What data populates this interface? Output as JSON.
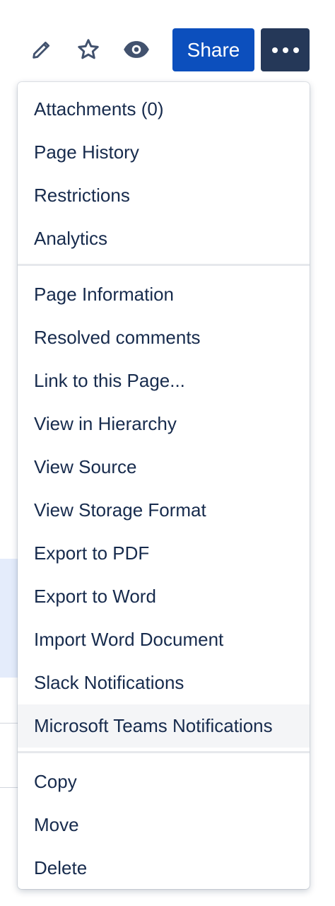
{
  "colors": {
    "primary": "#0c4fbd",
    "dark_button": "#253858",
    "text": "#172b4d",
    "icon": "#42526e",
    "highlight": "#f4f5f7"
  },
  "toolbar": {
    "icons": [
      "pencil-icon",
      "star-icon",
      "eye-icon"
    ],
    "share_label": "Share",
    "more_icon": "ellipsis-icon"
  },
  "menu": {
    "groups": [
      {
        "items": [
          {
            "label": "Attachments (0)"
          },
          {
            "label": "Page History"
          },
          {
            "label": "Restrictions"
          },
          {
            "label": "Analytics"
          }
        ]
      },
      {
        "items": [
          {
            "label": "Page Information"
          },
          {
            "label": "Resolved comments"
          },
          {
            "label": "Link to this Page..."
          },
          {
            "label": "View in Hierarchy"
          },
          {
            "label": "View Source"
          },
          {
            "label": "View Storage Format"
          },
          {
            "label": "Export to PDF"
          },
          {
            "label": "Export to Word"
          },
          {
            "label": "Import Word Document"
          },
          {
            "label": "Slack Notifications"
          },
          {
            "label": "Microsoft Teams Notifications",
            "highlighted": true
          }
        ]
      },
      {
        "items": [
          {
            "label": "Copy"
          },
          {
            "label": "Move"
          },
          {
            "label": "Delete"
          }
        ]
      }
    ]
  }
}
